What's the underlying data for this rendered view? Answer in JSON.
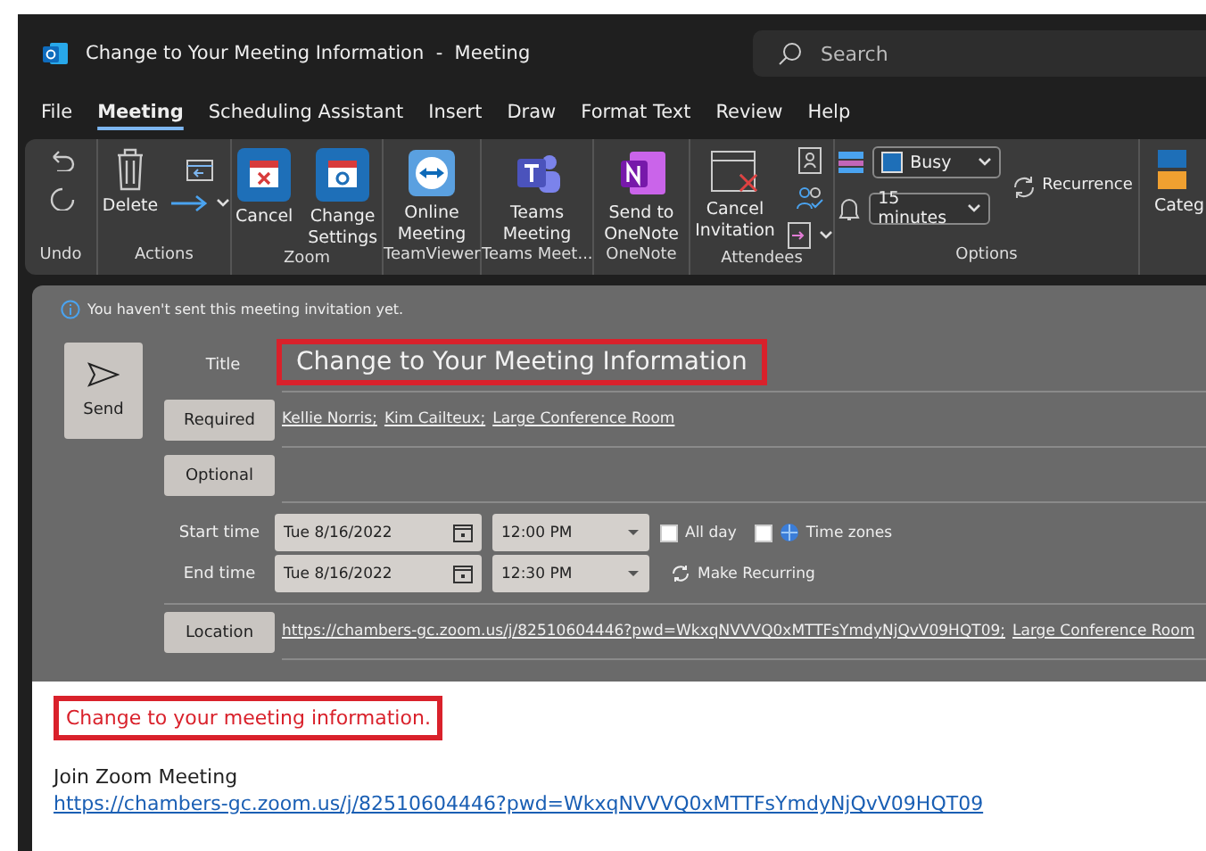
{
  "window": {
    "title": "Change to Your Meeting Information",
    "separator": "-",
    "item_type": "Meeting"
  },
  "search": {
    "placeholder": "Search"
  },
  "menu_tabs": [
    {
      "label": "File",
      "selected": false
    },
    {
      "label": "Meeting",
      "selected": true
    },
    {
      "label": "Scheduling Assistant",
      "selected": false
    },
    {
      "label": "Insert",
      "selected": false
    },
    {
      "label": "Draw",
      "selected": false
    },
    {
      "label": "Format Text",
      "selected": false
    },
    {
      "label": "Review",
      "selected": false
    },
    {
      "label": "Help",
      "selected": false
    }
  ],
  "ribbon_groups": [
    {
      "kind": "undo",
      "label": "Undo"
    },
    {
      "kind": "actions",
      "label": "Actions",
      "commands": [
        {
          "label": "Delete"
        }
      ]
    },
    {
      "kind": "zoom",
      "label": "Zoom",
      "commands": [
        {
          "label": "Cancel"
        },
        {
          "label": "Change Settings"
        }
      ]
    },
    {
      "kind": "teamviewer",
      "label": "TeamViewer",
      "commands": [
        {
          "label": "Online Meeting"
        }
      ]
    },
    {
      "kind": "teams",
      "label": "Teams Meet...",
      "commands": [
        {
          "label": "Teams Meeting"
        }
      ]
    },
    {
      "kind": "onenote",
      "label": "OneNote",
      "commands": [
        {
          "label": "Send to OneNote"
        }
      ]
    },
    {
      "kind": "attendees",
      "label": "Attendees",
      "commands": [
        {
          "label": "Cancel Invitation"
        }
      ]
    },
    {
      "kind": "options",
      "label": "Options",
      "show_as": "Busy",
      "reminder": "15 minutes",
      "recurrence": "Recurrence"
    },
    {
      "kind": "categorize",
      "commands": [
        {
          "label": "Categ"
        }
      ]
    }
  ],
  "form": {
    "notice": "You haven't sent this meeting invitation yet.",
    "send": "Send",
    "title_label": "Title",
    "title": "Change to Your Meeting Information",
    "title_highlighted": true,
    "required_button": "Required",
    "required": [
      "Kellie Norris;",
      "Kim Cailteux;",
      "Large Conference Room"
    ],
    "optional_button": "Optional",
    "start_label": "Start time",
    "start_date": "Tue 8/16/2022",
    "start_time": "12:00 PM",
    "all_day": {
      "label": "All day",
      "checked": false
    },
    "time_zones": {
      "label": "Time zones",
      "checked": false
    },
    "end_label": "End time",
    "end_date": "Tue 8/16/2022",
    "end_time": "12:30 PM",
    "make_recurring": "Make Recurring",
    "location_button": "Location",
    "location": [
      "https://chambers-gc.zoom.us/j/82510604446?pwd=WkxqNVVVQ0xMTTFsYmdyNjQvV09HQT09;",
      "Large Conference Room"
    ]
  },
  "body": {
    "highlighted_text": "Change to your meeting information.",
    "highlighted": true,
    "heading": "Join Zoom Meeting",
    "link": "https://chambers-gc.zoom.us/j/82510604446?pwd=WkxqNVVVQ0xMTTFsYmdyNjQvV09HQT09"
  }
}
